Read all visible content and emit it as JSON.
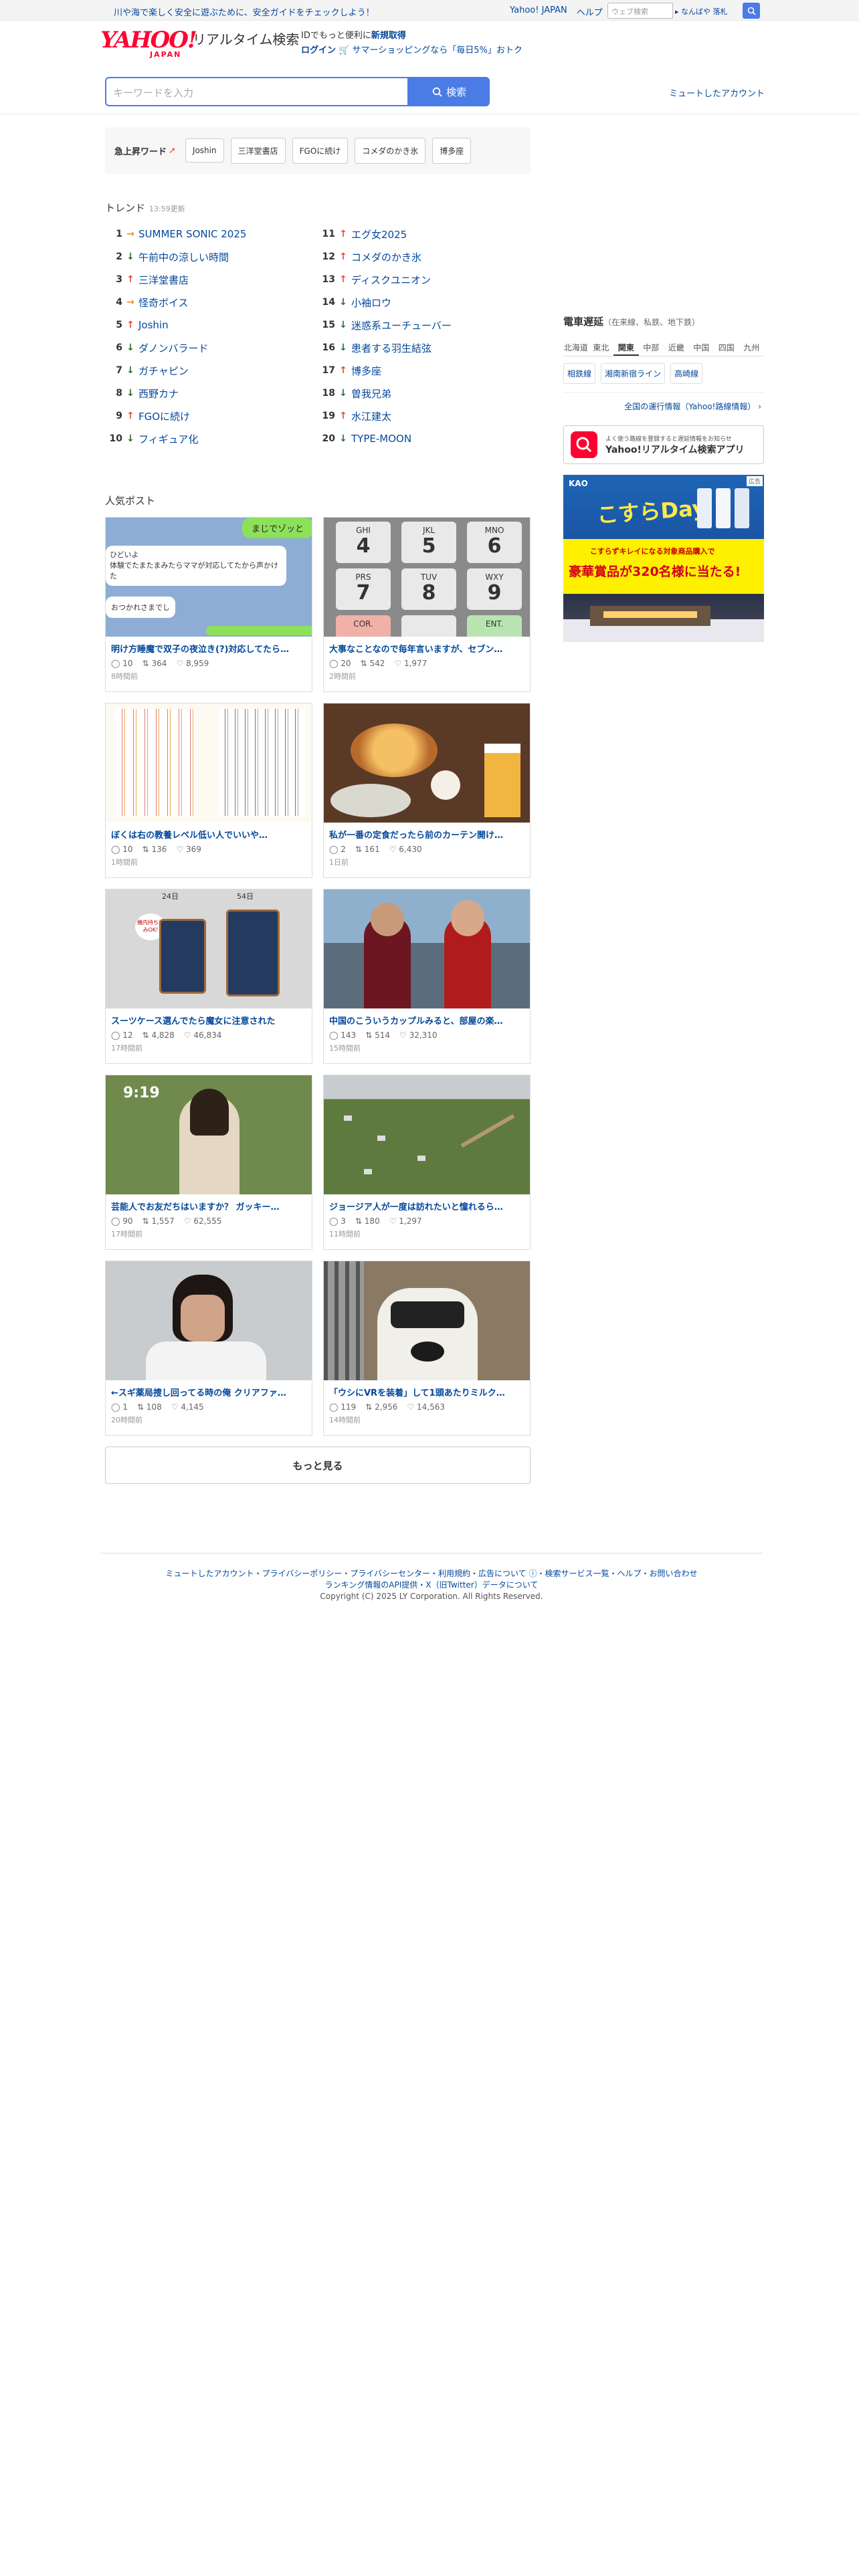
{
  "topbar": {
    "message": "川や海で楽しく安全に遊ぶために、安全ガイドをチェックしよう！",
    "links": [
      "Yahoo! JAPAN",
      "ヘルプ"
    ],
    "web_search_placeholder": "ウェブ検索",
    "keywords": "なんばや 落札"
  },
  "header": {
    "logo": "YAHOO!",
    "logo_sub": "JAPAN",
    "service_name": "リアルタイム検索",
    "login_line1_pre": "IDでもっと便利に",
    "login_line1_link": "新規取得",
    "login_link": "ログイン",
    "promo": "サマーショッピングなら「毎日5%」おトク",
    "search_placeholder": "キーワードを入力",
    "search_button": "検索",
    "muted_accounts": "ミュートしたアカウント"
  },
  "urgent": {
    "label": "急上昇ワード",
    "chips": [
      "Joshin",
      "三洋堂書店",
      "FGOに続け",
      "コメダのかき氷",
      "博多座"
    ]
  },
  "trend": {
    "title": "トレンド",
    "updated": "13:59更新",
    "items": [
      {
        "rank": "1",
        "dir": "fl",
        "text": "SUMMER SONIC 2025"
      },
      {
        "rank": "2",
        "dir": "dn",
        "text": "午前中の涼しい時間"
      },
      {
        "rank": "3",
        "dir": "up",
        "text": "三洋堂書店"
      },
      {
        "rank": "4",
        "dir": "fl",
        "text": "怪奇ボイス"
      },
      {
        "rank": "5",
        "dir": "up",
        "text": "Joshin"
      },
      {
        "rank": "6",
        "dir": "dn",
        "text": "ダノンバラード"
      },
      {
        "rank": "7",
        "dir": "dn",
        "text": "ガチャピン"
      },
      {
        "rank": "8",
        "dir": "dn",
        "text": "西野カナ"
      },
      {
        "rank": "9",
        "dir": "up",
        "text": "FGOに続け"
      },
      {
        "rank": "10",
        "dir": "dn",
        "text": "フィギュア化"
      },
      {
        "rank": "11",
        "dir": "up",
        "text": "エグ女2025"
      },
      {
        "rank": "12",
        "dir": "up",
        "text": "コメダのかき氷"
      },
      {
        "rank": "13",
        "dir": "up",
        "text": "ディスクユニオン"
      },
      {
        "rank": "14",
        "dir": "dn",
        "text": "小袖ロウ"
      },
      {
        "rank": "15",
        "dir": "dn",
        "text": "迷惑系ユーチューバー"
      },
      {
        "rank": "16",
        "dir": "dn",
        "text": "患者する羽生結弦"
      },
      {
        "rank": "17",
        "dir": "up",
        "text": "博多座"
      },
      {
        "rank": "18",
        "dir": "dn",
        "text": "曽我兄弟"
      },
      {
        "rank": "19",
        "dir": "up",
        "text": "水江建太"
      },
      {
        "rank": "20",
        "dir": "dn",
        "text": "TYPE-MOON"
      }
    ]
  },
  "sidebar": {
    "train_title": "電車遅延",
    "train_sub": "（在来線、私鉄、地下鉄）",
    "regions": [
      "北海道",
      "東北",
      "関東",
      "中部",
      "近畿",
      "中国",
      "四国",
      "九州"
    ],
    "active_region": "関東",
    "lines": [
      "相鉄線",
      "湘南新宿ライン",
      "高崎線"
    ],
    "national_link": "全国の運行情報（Yahoo!路線情報）",
    "app_small": "よく使う路線を登録すると遅延情報をお知らせ",
    "app_name": "Yahoo!リアルタイム検索アプリ",
    "ad_label": "広告",
    "ad_brand": "KAO",
    "ad_headline": "こすらDay",
    "ad_sub": "こすらずキレイになる対象商品購入で",
    "ad_prize": "豪華賞品が320名様に当たる!"
  },
  "posts": {
    "title": "人気ポスト",
    "items": [
      {
        "title": "明け方睡魔で双子の夜泣き(?)対応してたら…",
        "replies": "10",
        "reposts": "364",
        "likes": "8,959",
        "time": "8時間前",
        "chat1": "まじでゾッと",
        "chat2": "ひどいよ\n体験でたまたまみたらママが対応してたから声かけた",
        "chat3": "おつかれさまでし"
      },
      {
        "title": "大事なことなので毎年言いますが、セブン…",
        "replies": "20",
        "reposts": "542",
        "likes": "1,977",
        "time": "2時間前",
        "keys": [
          "GHI",
          "JKL",
          "MNO",
          "PRS",
          "TUV",
          "WXY",
          "COR.",
          "",
          "ENT."
        ],
        "nums": [
          "4",
          "5",
          "6",
          "7",
          "8",
          "9",
          "",
          "",
          ""
        ]
      },
      {
        "title": "ぼくは右の教養レベル低い人でいいや…",
        "replies": "10",
        "reposts": "136",
        "likes": "369",
        "time": "1時間前"
      },
      {
        "title": "私が一番の定食だったら前のカーテン開け…",
        "replies": "2",
        "reposts": "161",
        "likes": "6,430",
        "time": "1日前"
      },
      {
        "title": "スーツケース選んでたら魔女に注意された",
        "replies": "12",
        "reposts": "4,828",
        "likes": "46,834",
        "time": "17時間前",
        "l1": "24日",
        "l2": "54日",
        "l3": "機内持ち込みOK!"
      },
      {
        "title": "中国のこういうカップルみると、部屋の楽…",
        "replies": "143",
        "reposts": "514",
        "likes": "32,310",
        "time": "15時間前"
      },
      {
        "title": "芸能人でお友だちはいますか？ ガッキー…",
        "replies": "90",
        "reposts": "1,557",
        "likes": "62,555",
        "time": "17時間前",
        "clock": "9:19"
      },
      {
        "title": "ジョージア人が一度は訪れたいと憧れるら…",
        "replies": "3",
        "reposts": "180",
        "likes": "1,297",
        "time": "11時間前"
      },
      {
        "title": "←スギ薬局捜し回ってる時の俺 クリアファ…",
        "replies": "1",
        "reposts": "108",
        "likes": "4,145",
        "time": "20時間前"
      },
      {
        "title": "「ウシにVRを装着」して1頭あたりミルク…",
        "replies": "119",
        "reposts": "2,956",
        "likes": "14,563",
        "time": "14時間前"
      }
    ],
    "more": "もっと見る"
  },
  "footer": {
    "line1": "ミュートしたアカウント・プライバシーポリシー・プライバシーセンター・利用規約・広告について ⓘ・検索サービス一覧・ヘルプ・お問い合わせ",
    "line2": "ランキング情報のAPI提供・X（旧Twitter）データについて",
    "copyright": "Copyright (C) 2025 LY Corporation. All Rights Reserved."
  }
}
